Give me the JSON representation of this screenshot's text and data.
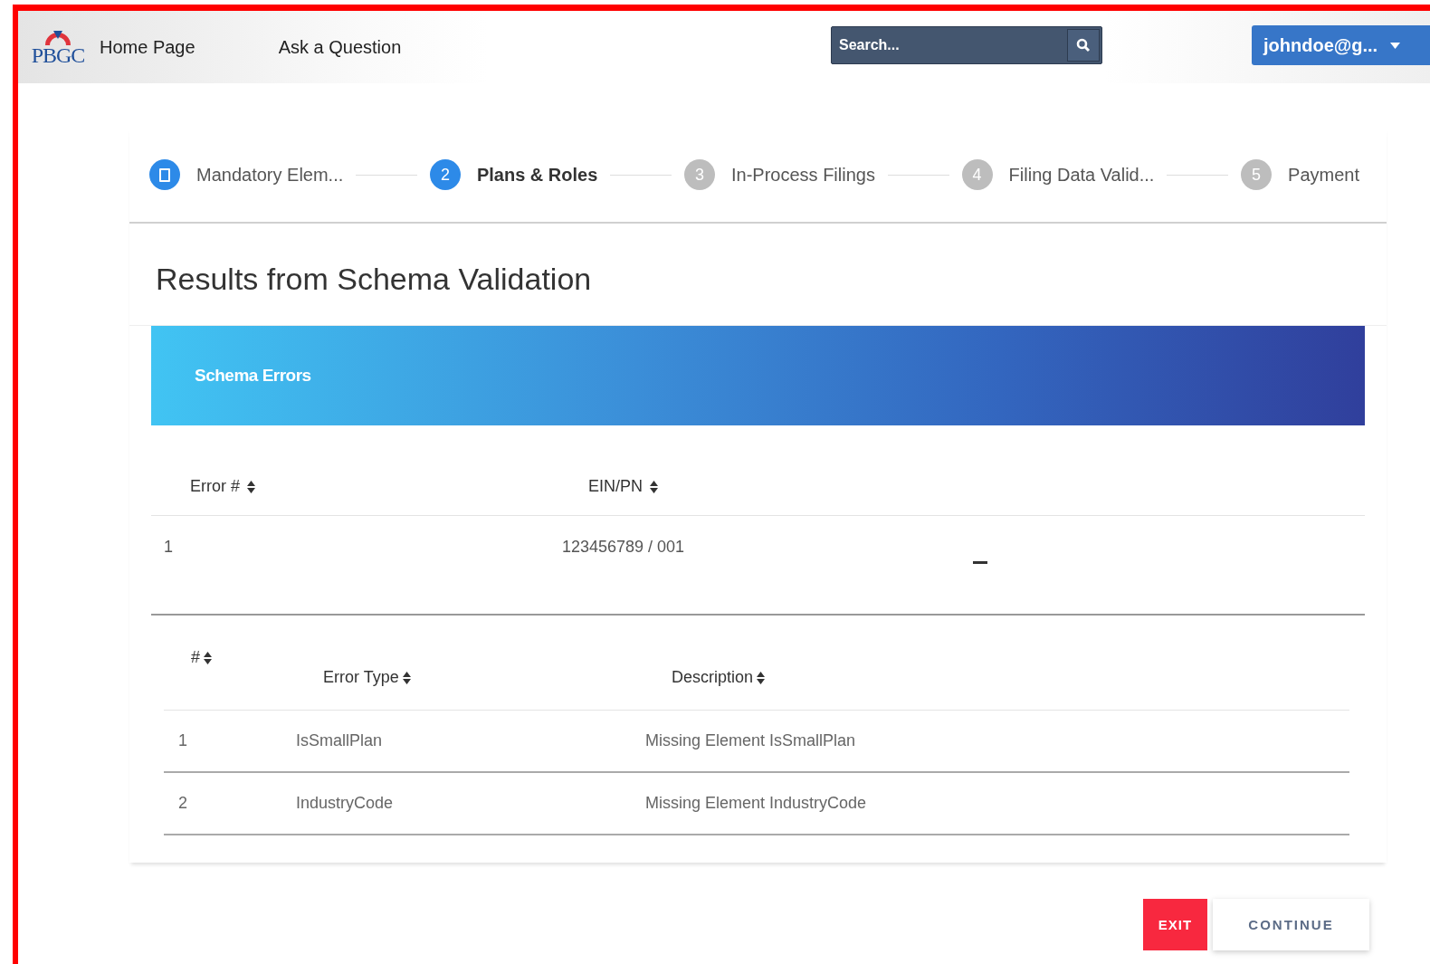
{
  "header": {
    "logo": "PBGC",
    "nav": [
      {
        "label": "Home Page"
      },
      {
        "label": "Ask a Question"
      }
    ],
    "search": {
      "placeholder": "Search..."
    },
    "user_menu": {
      "label": "johndoe@g..."
    }
  },
  "steps": [
    {
      "label": "Mandatory Elem...",
      "completed": true,
      "selected": false
    },
    {
      "number": "2",
      "label": "Plans & Roles",
      "completed": false,
      "selected": true
    },
    {
      "number": "3",
      "label": "In-Process Filings",
      "completed": false,
      "selected": false
    },
    {
      "number": "4",
      "label": "Filing Data Valid...",
      "completed": false,
      "selected": false
    },
    {
      "number": "5",
      "label": "Payment",
      "completed": false,
      "selected": false
    }
  ],
  "page_title": "Results from Schema Validation",
  "banner": {
    "title": "Schema Errors"
  },
  "table": {
    "columns": [
      "Error #",
      "EIN/PN"
    ],
    "rows": [
      {
        "cells": [
          "1",
          "123456789 / 001"
        ],
        "expanded": true
      }
    ]
  },
  "subtable": {
    "columns": [
      "#",
      "Error Type",
      "Description"
    ],
    "rows": [
      {
        "cells": [
          "1",
          "IsSmallPlan",
          "Missing Element IsSmallPlan"
        ]
      },
      {
        "cells": [
          "2",
          "IndustryCode",
          "Missing Element IndustryCode"
        ]
      }
    ]
  },
  "buttons": [
    {
      "label": "EXIT",
      "kind": "danger"
    },
    {
      "label": "CONTINUE",
      "kind": "secondary"
    }
  ]
}
